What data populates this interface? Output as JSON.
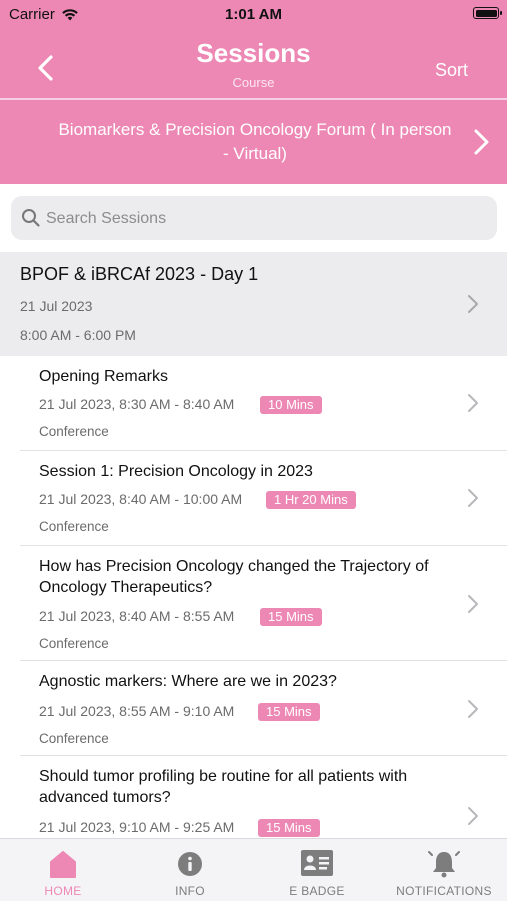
{
  "status": {
    "carrier": "Carrier",
    "time": "1:01 AM"
  },
  "nav": {
    "title": "Sessions",
    "subtitle": "Course",
    "sort_label": "Sort"
  },
  "course": {
    "name": "Biomarkers & Precision Oncology Forum ( In person - Virtual)"
  },
  "search": {
    "placeholder": "Search Sessions",
    "value": ""
  },
  "day": {
    "title": "BPOF & iBRCAf 2023 - Day 1",
    "date": "21 Jul 2023",
    "time": "8:00 AM - 6:00 PM"
  },
  "sessions": [
    {
      "title": "Opening Remarks",
      "time": "21 Jul 2023, 8:30 AM - 8:40 AM",
      "duration": "10 Mins",
      "type": "Conference"
    },
    {
      "title": "Session 1: Precision Oncology in 2023",
      "time": "21 Jul 2023, 8:40 AM - 10:00 AM",
      "duration": "1 Hr 20 Mins",
      "type": "Conference"
    },
    {
      "title": "How has Precision Oncology changed the Trajectory of Oncology Therapeutics?",
      "time": "21 Jul 2023, 8:40 AM - 8:55 AM",
      "duration": "15 Mins",
      "type": "Conference"
    },
    {
      "title": "Agnostic markers: Where are we in 2023?",
      "time": "21 Jul 2023, 8:55 AM - 9:10 AM",
      "duration": "15 Mins",
      "type": "Conference"
    },
    {
      "title": "Should tumor profiling be routine for all patients with advanced tumors?",
      "time": "21 Jul 2023, 9:10 AM - 9:25 AM",
      "duration": "15 Mins",
      "type": ""
    }
  ],
  "tabs": [
    {
      "label": "HOME",
      "icon": "home-icon",
      "active": true
    },
    {
      "label": "INFO",
      "icon": "info-icon",
      "active": false
    },
    {
      "label": "E BADGE",
      "icon": "badge-icon",
      "active": false
    },
    {
      "label": "NOTIFICATIONS",
      "icon": "bell-icon",
      "active": false
    }
  ],
  "colors": {
    "brand": "#ed88b4",
    "badge": "#ed88b4",
    "day_header_bg": "#ececef"
  }
}
